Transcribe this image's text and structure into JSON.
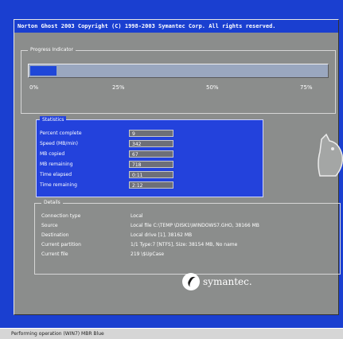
{
  "window": {
    "title": "Norton Ghost 2003   Copyright (C) 1998-2003 Symantec Corp. All rights reserved."
  },
  "progress": {
    "label": "Progress Indicator",
    "fraction": 0.09,
    "ticks": [
      "0%",
      "25%",
      "50%",
      "75%"
    ]
  },
  "statistics": {
    "label": "Statistics",
    "rows": [
      {
        "label": "Percent complete",
        "value": "9"
      },
      {
        "label": "Speed (MB/min)",
        "value": "342"
      },
      {
        "label": "MB copied",
        "value": "67"
      },
      {
        "label": "MB remaining",
        "value": "718"
      },
      {
        "label": "Time elapsed",
        "value": "0:11"
      },
      {
        "label": "Time remaining",
        "value": "2:12"
      }
    ]
  },
  "details": {
    "label": "Details",
    "rows": [
      {
        "key": "Connection type",
        "value": "Local"
      },
      {
        "key": "Source",
        "value": "Local file C:\\TEMP  \\DISK1\\WINDOWS7.GHO, 38166 MB"
      },
      {
        "key": "Destination",
        "value": "Local drive [1], 38162 MB"
      },
      {
        "key": "Current partition",
        "value": "1/1 Type:7 [NTFS], Size: 38154 MB, No name"
      },
      {
        "key": "Current file",
        "value": "219 \\$UpCase"
      }
    ]
  },
  "brand": {
    "name": "symantec."
  },
  "taskbar": {
    "item": "Performing operation (WIN7) MBR Blue"
  },
  "colors": {
    "screen": "#1a3fd0",
    "window": "#8b8d8c",
    "stats_panel": "#2342dc"
  }
}
